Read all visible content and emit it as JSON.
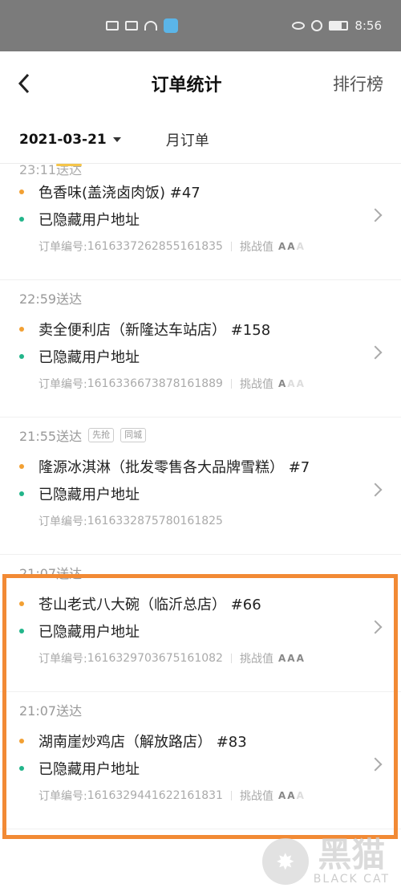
{
  "status_bar": {
    "time": "8:56"
  },
  "nav": {
    "title": "订单统计",
    "right_label": "排行榜"
  },
  "filter": {
    "date": "2021-03-21",
    "month_tab": "月订单"
  },
  "first_header_partial": "23:11送达",
  "orders": [
    {
      "store": "色香味(盖浇卤肉饭) #47",
      "address": "已隐藏用户地址",
      "order_label": "订单编号:",
      "order_no": "1616337262855161835",
      "challenge_label": "挑战值",
      "rating": 3,
      "rating_active": [
        true,
        true,
        false
      ]
    },
    {
      "header_time": "22:59送达",
      "store": "卖全便利店（新隆达车站店） #158",
      "address": "已隐藏用户地址",
      "order_label": "订单编号:",
      "order_no": "1616336673878161889",
      "challenge_label": "挑战值",
      "rating_active": [
        true,
        false,
        false
      ]
    },
    {
      "header_time": "21:55送达",
      "tags": [
        "先抢",
        "同城"
      ],
      "store": "隆源冰淇淋（批发零售各大品牌雪糕） #7",
      "address": "已隐藏用户地址",
      "order_label": "订单编号:",
      "order_no": "1616332875780161825"
    },
    {
      "header_time": "21:07送达",
      "store": "苍山老式八大碗（临沂总店） #66",
      "address": "已隐藏用户地址",
      "order_label": "订单编号:",
      "order_no": "1616329703675161082",
      "challenge_label": "挑战值",
      "rating_active": [
        true,
        true,
        true
      ]
    },
    {
      "header_time": "21:07送达",
      "store": "湖南崖炒鸡店（解放路店） #83",
      "address": "已隐藏用户地址",
      "order_label": "订单编号:",
      "order_no": "1616329441622161831",
      "challenge_label": "挑战值",
      "rating_active": [
        true,
        true,
        false
      ]
    }
  ],
  "watermark": {
    "cn": "黑猫",
    "en": "BLACK CAT"
  },
  "colors": {
    "highlight": "#f28a35",
    "dot_orange": "#f2a033",
    "dot_green": "#22b58a"
  }
}
